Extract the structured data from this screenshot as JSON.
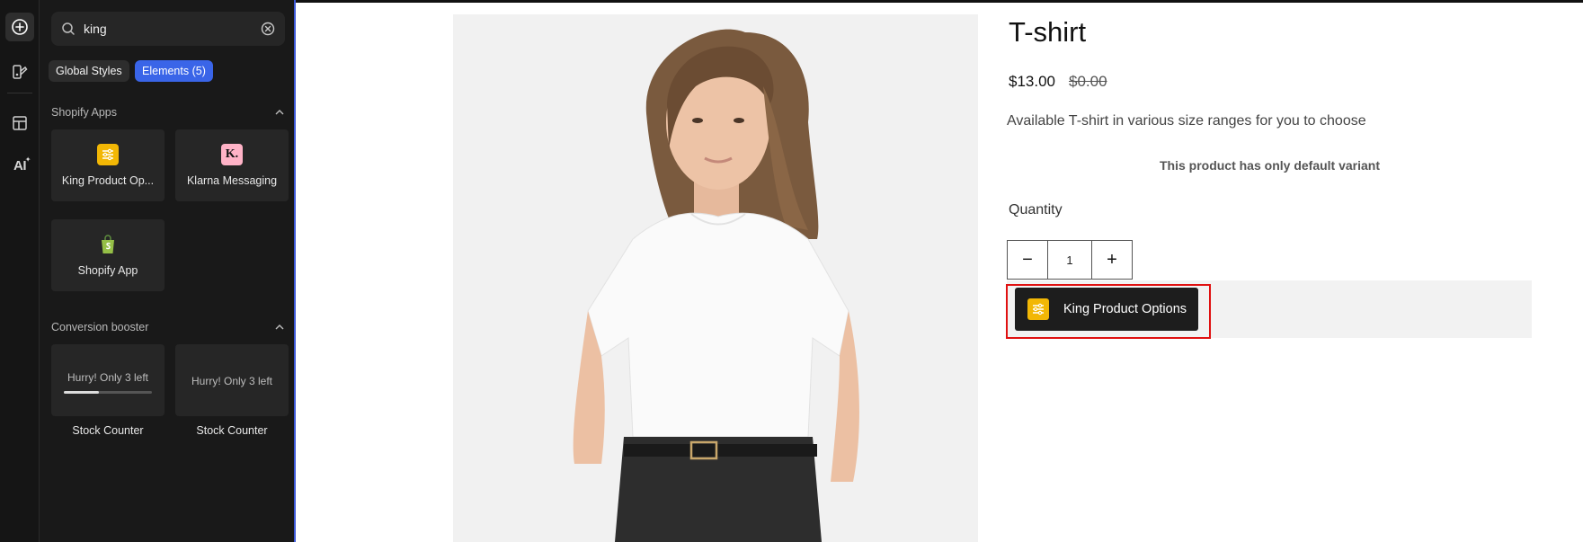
{
  "rail": {
    "icons": [
      "add-icon",
      "global-styles-icon",
      "layout-icon",
      "ai-icon"
    ],
    "ai_label": "AI"
  },
  "search": {
    "value": "king"
  },
  "chips": {
    "global_styles": "Global Styles",
    "elements": "Elements (5)"
  },
  "sections": {
    "shopify_apps": {
      "title": "Shopify Apps",
      "items": [
        {
          "label": "King Product Op...",
          "icon": "king-product-options-icon"
        },
        {
          "label": "Klarna Messaging",
          "icon": "klarna-icon",
          "glyph": "K."
        },
        {
          "label": "Shopify App",
          "icon": "shopify-bag-icon"
        }
      ]
    },
    "conversion_booster": {
      "title": "Conversion booster",
      "items": [
        {
          "preview": "Hurry! Only 3 left",
          "label": "Stock Counter",
          "progress": 0.4
        },
        {
          "preview": "Hurry! Only 3 left",
          "label": "Stock Counter"
        }
      ]
    }
  },
  "product": {
    "title": "T-shirt",
    "price": "$13.00",
    "compare_price": "$0.00",
    "description": "Available T-shirt in various size ranges for you to choose",
    "variant_note": "This product has only default variant",
    "quantity_label": "Quantity",
    "quantity_value": "1",
    "minus": "−",
    "plus": "+",
    "app_button_label": "King Product Options"
  },
  "colors": {
    "accent": "#3a65e8",
    "king_icon": "#f2b705",
    "klarna_icon": "#ffb3c7",
    "highlight": "#e01010"
  }
}
